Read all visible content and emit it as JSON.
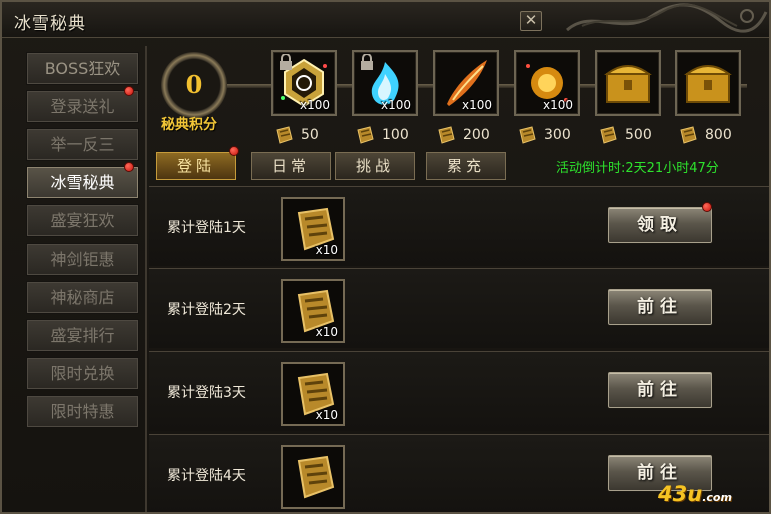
{
  "window": {
    "title": "冰雪秘典",
    "close_glyph": "✕"
  },
  "nav": {
    "items": [
      {
        "label": "BOSS狂欢",
        "badge": false,
        "active": false
      },
      {
        "label": "登录送礼",
        "badge": true,
        "active": false
      },
      {
        "label": "举一反三",
        "badge": false,
        "active": false
      },
      {
        "label": "冰雪秘典",
        "badge": true,
        "active": true
      },
      {
        "label": "盛宴狂欢",
        "badge": false,
        "active": false
      },
      {
        "label": "神剑钜惠",
        "badge": false,
        "active": false
      },
      {
        "label": "神秘商店",
        "badge": false,
        "active": false
      },
      {
        "label": "盛宴排行",
        "badge": false,
        "active": false
      },
      {
        "label": "限时兑换",
        "badge": false,
        "active": false
      },
      {
        "label": "限时特惠",
        "badge": false,
        "active": false
      }
    ]
  },
  "score": {
    "value": "0",
    "label": "秘典积分"
  },
  "rewards": [
    {
      "icon": "rune-emblem-icon",
      "qty": "x100",
      "cost": "50",
      "locked": true
    },
    {
      "icon": "blue-flame-icon",
      "qty": "x100",
      "cost": "100",
      "locked": true
    },
    {
      "icon": "fire-feather-icon",
      "qty": "x100",
      "cost": "200",
      "locked": false
    },
    {
      "icon": "gold-gem-icon",
      "qty": "x100",
      "cost": "300",
      "locked": false
    },
    {
      "icon": "treasure-chest-icon",
      "qty": "",
      "cost": "500",
      "locked": false
    },
    {
      "icon": "treasure-chest-icon",
      "qty": "",
      "cost": "800",
      "locked": false
    }
  ],
  "tabs": [
    {
      "label": "登陆",
      "active": true,
      "badge": true
    },
    {
      "label": "日常",
      "active": false,
      "badge": false
    },
    {
      "label": "挑战",
      "active": false,
      "badge": false
    },
    {
      "label": "累充",
      "active": false,
      "badge": false
    }
  ],
  "countdown": "活动倒计时:2天21小时47分",
  "rows": [
    {
      "label": "累计登陆1天",
      "qty": "x10",
      "button": "领取",
      "badge": true
    },
    {
      "label": "累计登陆2天",
      "qty": "x10",
      "button": "前往",
      "badge": false
    },
    {
      "label": "累计登陆3天",
      "qty": "x10",
      "button": "前往",
      "badge": false
    },
    {
      "label": "累计登陆4天",
      "qty": "",
      "button": "前往",
      "badge": false
    }
  ],
  "watermark": {
    "main": "43u",
    "suffix": ".com"
  },
  "colors": {
    "gold": "#f2c637",
    "green": "#2de22d",
    "badge_red": "#d8170e"
  }
}
